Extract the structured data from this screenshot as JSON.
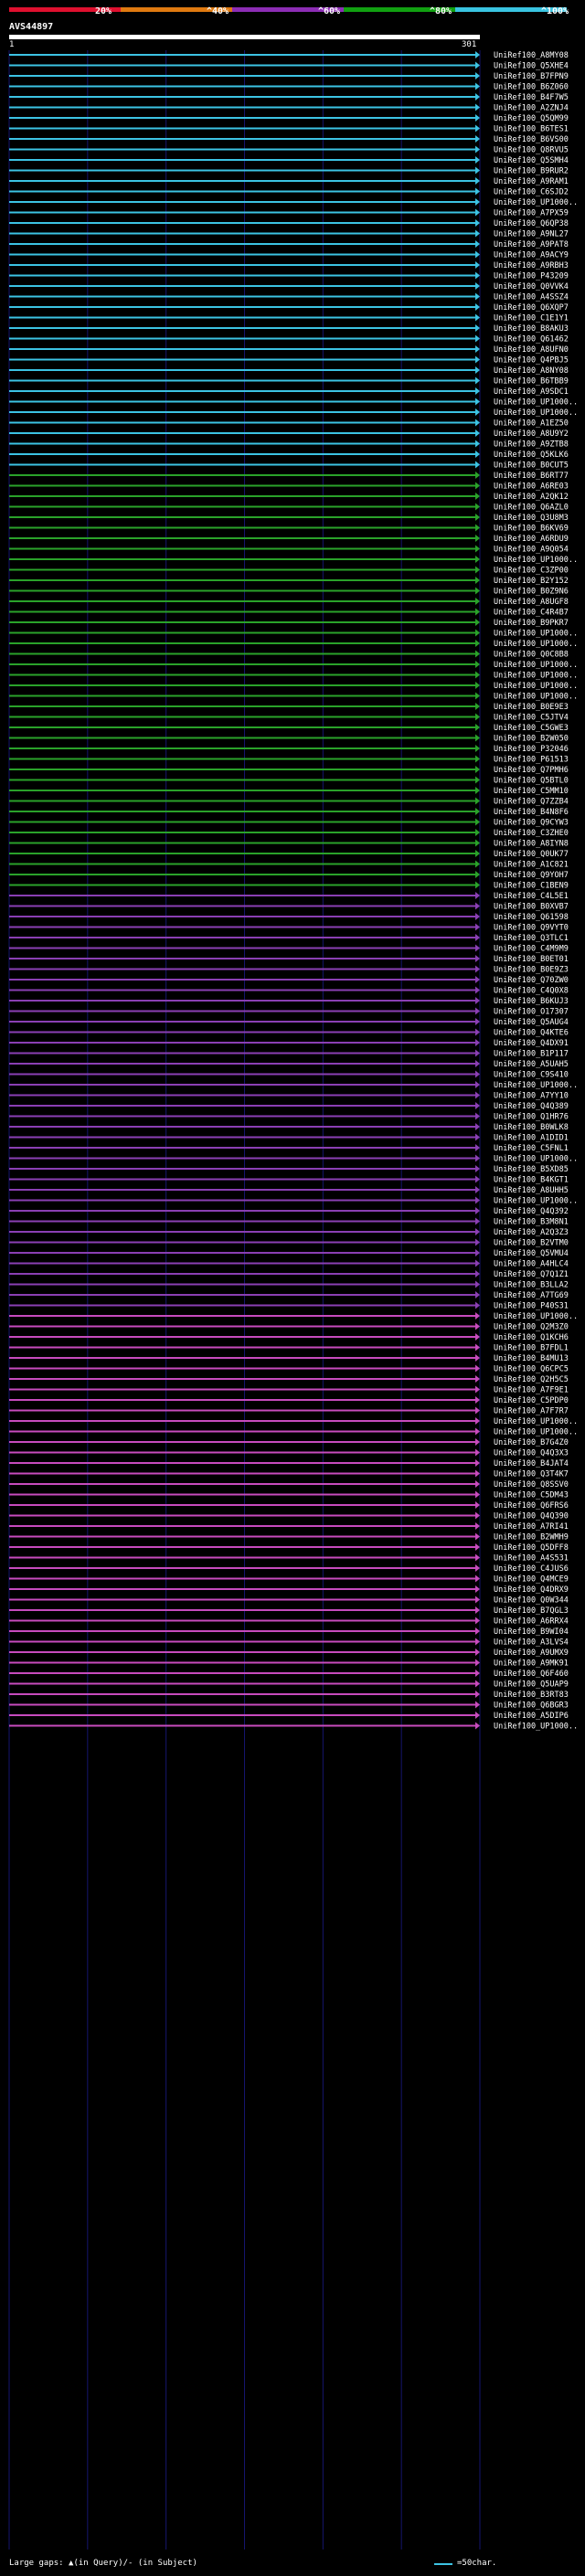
{
  "legend": {
    "labels": [
      "20%",
      "^40%",
      "^60%",
      "^80%",
      "^100%"
    ],
    "colors": [
      "#e0102f",
      "#e07a10",
      "#8d2db5",
      "#11a011",
      "#39c4e1"
    ]
  },
  "query": {
    "name": "AVS44897",
    "start": "1",
    "end": "301"
  },
  "colors": {
    "cyan": "#3cc3e3",
    "green": "#2aa22a",
    "magenta": "#c74bbd",
    "purple": "#8a3fb3",
    "grid": "#15156e",
    "query": "#ffffff"
  },
  "footer": {
    "gaps": "Large gaps: ▲(in Query)/- (in Subject)",
    "scale": "=50char."
  },
  "chart_data": {
    "type": "alignment-overview",
    "query_length": 301,
    "hits": [
      {
        "id": "UniRef100_A8MY08",
        "start": 1,
        "end": 301,
        "identity": 100
      },
      {
        "id": "UniRef100_Q5XHE4",
        "start": 1,
        "end": 301,
        "identity": 99
      },
      {
        "id": "UniRef100_B7FPN9",
        "start": 1,
        "end": 301,
        "identity": 98
      },
      {
        "id": "UniRef100_B6Z060",
        "start": 1,
        "end": 301,
        "identity": 98
      },
      {
        "id": "UniRef100_B4F7W5",
        "start": 1,
        "end": 301,
        "identity": 97
      },
      {
        "id": "UniRef100_A2ZNJ4",
        "start": 1,
        "end": 301,
        "identity": 97
      },
      {
        "id": "UniRef100_Q5QM99",
        "start": 1,
        "end": 301,
        "identity": 96
      },
      {
        "id": "UniRef100_B6TES1",
        "start": 1,
        "end": 301,
        "identity": 96
      },
      {
        "id": "UniRef100_B6VS00",
        "start": 1,
        "end": 301,
        "identity": 95
      },
      {
        "id": "UniRef100_Q8RVU5",
        "start": 1,
        "end": 301,
        "identity": 95
      },
      {
        "id": "UniRef100_Q5SMH4",
        "start": 1,
        "end": 301,
        "identity": 94
      },
      {
        "id": "UniRef100_B9RUR2",
        "start": 1,
        "end": 301,
        "identity": 94
      },
      {
        "id": "UniRef100_A9RAM1",
        "start": 1,
        "end": 301,
        "identity": 93
      },
      {
        "id": "UniRef100_C6SJD2",
        "start": 1,
        "end": 301,
        "identity": 93
      },
      {
        "id": "UniRef100_UP1000..",
        "start": 1,
        "end": 301,
        "identity": 92
      },
      {
        "id": "UniRef100_A7PX59",
        "start": 1,
        "end": 301,
        "identity": 92
      },
      {
        "id": "UniRef100_Q6QP38",
        "start": 1,
        "end": 301,
        "identity": 91
      },
      {
        "id": "UniRef100_A9NL27",
        "start": 1,
        "end": 301,
        "identity": 91
      },
      {
        "id": "UniRef100_A9PAT8",
        "start": 1,
        "end": 301,
        "identity": 90
      },
      {
        "id": "UniRef100_A9ACY9",
        "start": 1,
        "end": 301,
        "identity": 90
      },
      {
        "id": "UniRef100_A9RBH3",
        "start": 1,
        "end": 301,
        "identity": 89
      },
      {
        "id": "UniRef100_P43209",
        "start": 1,
        "end": 301,
        "identity": 89
      },
      {
        "id": "UniRef100_Q0VVK4",
        "start": 1,
        "end": 301,
        "identity": 88
      },
      {
        "id": "UniRef100_A4SSZ4",
        "start": 1,
        "end": 301,
        "identity": 88
      },
      {
        "id": "UniRef100_Q6XQP7",
        "start": 1,
        "end": 301,
        "identity": 87
      },
      {
        "id": "UniRef100_C1E1Y1",
        "start": 1,
        "end": 301,
        "identity": 87
      },
      {
        "id": "UniRef100_B8AKU3",
        "start": 1,
        "end": 301,
        "identity": 86
      },
      {
        "id": "UniRef100_Q61462",
        "start": 1,
        "end": 301,
        "identity": 86
      },
      {
        "id": "UniRef100_A8UFN0",
        "start": 1,
        "end": 301,
        "identity": 85
      },
      {
        "id": "UniRef100_Q4PBJ5",
        "start": 1,
        "end": 301,
        "identity": 85
      },
      {
        "id": "UniRef100_A8NY08",
        "start": 1,
        "end": 301,
        "identity": 84
      },
      {
        "id": "UniRef100_B6TBB9",
        "start": 1,
        "end": 301,
        "identity": 84
      },
      {
        "id": "UniRef100_A9SDC1",
        "start": 1,
        "end": 301,
        "identity": 83
      },
      {
        "id": "UniRef100_UP1000..",
        "start": 1,
        "end": 301,
        "identity": 83
      },
      {
        "id": "UniRef100_UP1000..",
        "start": 1,
        "end": 301,
        "identity": 82
      },
      {
        "id": "UniRef100_A1EZ50",
        "start": 1,
        "end": 301,
        "identity": 82
      },
      {
        "id": "UniRef100_A8U9Y2",
        "start": 1,
        "end": 301,
        "identity": 81
      },
      {
        "id": "UniRef100_A9ZTB8",
        "start": 1,
        "end": 301,
        "identity": 81
      },
      {
        "id": "UniRef100_Q5KLK6",
        "start": 1,
        "end": 301,
        "identity": 80
      },
      {
        "id": "UniRef100_B0CUT5",
        "start": 1,
        "end": 301,
        "identity": 80
      },
      {
        "id": "UniRef100_B6RT77",
        "start": 1,
        "end": 301,
        "identity": 79
      },
      {
        "id": "UniRef100_A6RE03",
        "start": 1,
        "end": 301,
        "identity": 79
      },
      {
        "id": "UniRef100_A2QK12",
        "start": 1,
        "end": 301,
        "identity": 78
      },
      {
        "id": "UniRef100_Q6AZL0",
        "start": 1,
        "end": 301,
        "identity": 78
      },
      {
        "id": "UniRef100_Q3U8M3",
        "start": 1,
        "end": 301,
        "identity": 77
      },
      {
        "id": "UniRef100_B6KV69",
        "start": 1,
        "end": 301,
        "identity": 77
      },
      {
        "id": "UniRef100_A6RDU9",
        "start": 1,
        "end": 301,
        "identity": 76
      },
      {
        "id": "UniRef100_A9Q054",
        "start": 1,
        "end": 301,
        "identity": 76
      },
      {
        "id": "UniRef100_UP1000..",
        "start": 1,
        "end": 301,
        "identity": 75
      },
      {
        "id": "UniRef100_C3ZP00",
        "start": 1,
        "end": 301,
        "identity": 75
      },
      {
        "id": "UniRef100_B2Y152",
        "start": 1,
        "end": 301,
        "identity": 74
      },
      {
        "id": "UniRef100_B0Z9N6",
        "start": 1,
        "end": 301,
        "identity": 74
      },
      {
        "id": "UniRef100_A8UGF8",
        "start": 1,
        "end": 301,
        "identity": 73
      },
      {
        "id": "UniRef100_C4R4B7",
        "start": 1,
        "end": 301,
        "identity": 73
      },
      {
        "id": "UniRef100_B9PKR7",
        "start": 1,
        "end": 301,
        "identity": 72
      },
      {
        "id": "UniRef100_UP1000..",
        "start": 1,
        "end": 301,
        "identity": 72
      },
      {
        "id": "UniRef100_UP1000..",
        "start": 1,
        "end": 301,
        "identity": 71
      },
      {
        "id": "UniRef100_Q0C8B8",
        "start": 1,
        "end": 301,
        "identity": 71
      },
      {
        "id": "UniRef100_UP1000..",
        "start": 1,
        "end": 301,
        "identity": 70
      },
      {
        "id": "UniRef100_UP1000..",
        "start": 1,
        "end": 301,
        "identity": 70
      },
      {
        "id": "UniRef100_UP1000..",
        "start": 1,
        "end": 301,
        "identity": 69
      },
      {
        "id": "UniRef100_UP1000..",
        "start": 1,
        "end": 301,
        "identity": 69
      },
      {
        "id": "UniRef100_B0E9E3",
        "start": 1,
        "end": 301,
        "identity": 68
      },
      {
        "id": "UniRef100_C5JTV4",
        "start": 1,
        "end": 301,
        "identity": 68
      },
      {
        "id": "UniRef100_C5GWE3",
        "start": 1,
        "end": 301,
        "identity": 67
      },
      {
        "id": "UniRef100_B2W050",
        "start": 1,
        "end": 301,
        "identity": 67
      },
      {
        "id": "UniRef100_P32046",
        "start": 1,
        "end": 301,
        "identity": 66
      },
      {
        "id": "UniRef100_P61513",
        "start": 1,
        "end": 301,
        "identity": 66
      },
      {
        "id": "UniRef100_Q7PMH6",
        "start": 1,
        "end": 301,
        "identity": 65
      },
      {
        "id": "UniRef100_Q5BTL0",
        "start": 1,
        "end": 301,
        "identity": 65
      },
      {
        "id": "UniRef100_C5MM10",
        "start": 1,
        "end": 301,
        "identity": 64
      },
      {
        "id": "UniRef100_Q7ZZB4",
        "start": 1,
        "end": 301,
        "identity": 64
      },
      {
        "id": "UniRef100_B4N8F6",
        "start": 1,
        "end": 301,
        "identity": 63
      },
      {
        "id": "UniRef100_Q9CYW3",
        "start": 1,
        "end": 301,
        "identity": 63
      },
      {
        "id": "UniRef100_C3ZHE0",
        "start": 1,
        "end": 301,
        "identity": 62
      },
      {
        "id": "UniRef100_A8IYN8",
        "start": 1,
        "end": 301,
        "identity": 62
      },
      {
        "id": "UniRef100_Q0UK77",
        "start": 1,
        "end": 301,
        "identity": 61
      },
      {
        "id": "UniRef100_A1C821",
        "start": 1,
        "end": 301,
        "identity": 61
      },
      {
        "id": "UniRef100_Q9YOH7",
        "start": 1,
        "end": 301,
        "identity": 60
      },
      {
        "id": "UniRef100_C1BEN9",
        "start": 1,
        "end": 301,
        "identity": 60
      },
      {
        "id": "UniRef100_C4L5E1",
        "start": 1,
        "end": 301,
        "identity": 59
      },
      {
        "id": "UniRef100_B0XVB7",
        "start": 1,
        "end": 301,
        "identity": 59
      },
      {
        "id": "UniRef100_Q61598",
        "start": 1,
        "end": 301,
        "identity": 58
      },
      {
        "id": "UniRef100_Q9VYT0",
        "start": 1,
        "end": 301,
        "identity": 58
      },
      {
        "id": "UniRef100_Q3TLC1",
        "start": 1,
        "end": 301,
        "identity": 57
      },
      {
        "id": "UniRef100_C4M9M9",
        "start": 1,
        "end": 301,
        "identity": 57
      },
      {
        "id": "UniRef100_B0ET01",
        "start": 1,
        "end": 301,
        "identity": 56
      },
      {
        "id": "UniRef100_B0E9Z3",
        "start": 1,
        "end": 301,
        "identity": 56
      },
      {
        "id": "UniRef100_Q70ZW0",
        "start": 1,
        "end": 301,
        "identity": 55
      },
      {
        "id": "UniRef100_C4Q0X8",
        "start": 1,
        "end": 301,
        "identity": 55
      },
      {
        "id": "UniRef100_B6KUJ3",
        "start": 1,
        "end": 301,
        "identity": 54
      },
      {
        "id": "UniRef100_O17307",
        "start": 1,
        "end": 301,
        "identity": 54
      },
      {
        "id": "UniRef100_Q5AUG4",
        "start": 1,
        "end": 301,
        "identity": 53
      },
      {
        "id": "UniRef100_Q4KTE6",
        "start": 1,
        "end": 301,
        "identity": 53
      },
      {
        "id": "UniRef100_Q4DX91",
        "start": 1,
        "end": 301,
        "identity": 52
      },
      {
        "id": "UniRef100_B1P117",
        "start": 1,
        "end": 301,
        "identity": 52
      },
      {
        "id": "UniRef100_A5UAH5",
        "start": 1,
        "end": 301,
        "identity": 51
      },
      {
        "id": "UniRef100_C9S410",
        "start": 1,
        "end": 301,
        "identity": 51
      },
      {
        "id": "UniRef100_UP1000..",
        "start": 1,
        "end": 301,
        "identity": 50
      },
      {
        "id": "UniRef100_A7YY10",
        "start": 1,
        "end": 301,
        "identity": 50
      },
      {
        "id": "UniRef100_Q4Q389",
        "start": 1,
        "end": 301,
        "identity": 49
      },
      {
        "id": "UniRef100_Q1HR76",
        "start": 1,
        "end": 301,
        "identity": 49
      },
      {
        "id": "UniRef100_B0WLK8",
        "start": 1,
        "end": 301,
        "identity": 48
      },
      {
        "id": "UniRef100_A1DID1",
        "start": 1,
        "end": 301,
        "identity": 48
      },
      {
        "id": "UniRef100_C5FNL1",
        "start": 1,
        "end": 301,
        "identity": 47
      },
      {
        "id": "UniRef100_UP1000..",
        "start": 1,
        "end": 301,
        "identity": 47
      },
      {
        "id": "UniRef100_B5XD85",
        "start": 1,
        "end": 301,
        "identity": 46
      },
      {
        "id": "UniRef100_B4KGT1",
        "start": 1,
        "end": 301,
        "identity": 46
      },
      {
        "id": "UniRef100_A8UHH5",
        "start": 1,
        "end": 301,
        "identity": 45
      },
      {
        "id": "UniRef100_UP1000..",
        "start": 1,
        "end": 301,
        "identity": 45
      },
      {
        "id": "UniRef100_Q4Q392",
        "start": 1,
        "end": 301,
        "identity": 44
      },
      {
        "id": "UniRef100_B3M8N1",
        "start": 1,
        "end": 301,
        "identity": 44
      },
      {
        "id": "UniRef100_A2Q3Z3",
        "start": 1,
        "end": 301,
        "identity": 43
      },
      {
        "id": "UniRef100_B2VTM0",
        "start": 1,
        "end": 301,
        "identity": 43
      },
      {
        "id": "UniRef100_Q5VMU4",
        "start": 1,
        "end": 301,
        "identity": 42
      },
      {
        "id": "UniRef100_A4HLC4",
        "start": 1,
        "end": 301,
        "identity": 42
      },
      {
        "id": "UniRef100_Q7Q1Z1",
        "start": 1,
        "end": 301,
        "identity": 41
      },
      {
        "id": "UniRef100_B3LLA2",
        "start": 1,
        "end": 301,
        "identity": 41
      },
      {
        "id": "UniRef100_A7TG69",
        "start": 1,
        "end": 301,
        "identity": 40
      },
      {
        "id": "UniRef100_P40S31",
        "start": 1,
        "end": 301,
        "identity": 40
      },
      {
        "id": "UniRef100_UP1000..",
        "start": 1,
        "end": 301,
        "identity": 39
      },
      {
        "id": "UniRef100_Q2M3Z0",
        "start": 1,
        "end": 301,
        "identity": 39
      },
      {
        "id": "UniRef100_Q1KCH6",
        "start": 1,
        "end": 301,
        "identity": 38
      },
      {
        "id": "UniRef100_B7FDL1",
        "start": 1,
        "end": 301,
        "identity": 38
      },
      {
        "id": "UniRef100_B4MU13",
        "start": 1,
        "end": 301,
        "identity": 37
      },
      {
        "id": "UniRef100_Q6CPC5",
        "start": 1,
        "end": 301,
        "identity": 37
      },
      {
        "id": "UniRef100_Q2H5C5",
        "start": 1,
        "end": 301,
        "identity": 36
      },
      {
        "id": "UniRef100_A7F9E1",
        "start": 1,
        "end": 301,
        "identity": 36
      },
      {
        "id": "UniRef100_C5PDP0",
        "start": 1,
        "end": 301,
        "identity": 35
      },
      {
        "id": "UniRef100_A7F7R7",
        "start": 1,
        "end": 301,
        "identity": 35
      },
      {
        "id": "UniRef100_UP1000..",
        "start": 1,
        "end": 301,
        "identity": 34
      },
      {
        "id": "UniRef100_UP1000..",
        "start": 1,
        "end": 301,
        "identity": 34
      },
      {
        "id": "UniRef100_B7G4Z0",
        "start": 1,
        "end": 301,
        "identity": 33
      },
      {
        "id": "UniRef100_Q4Q3X3",
        "start": 1,
        "end": 301,
        "identity": 33
      },
      {
        "id": "UniRef100_B4JAT4",
        "start": 1,
        "end": 301,
        "identity": 32
      },
      {
        "id": "UniRef100_Q3T4K7",
        "start": 1,
        "end": 301,
        "identity": 32
      },
      {
        "id": "UniRef100_Q8SSV0",
        "start": 1,
        "end": 301,
        "identity": 31
      },
      {
        "id": "UniRef100_C5DM43",
        "start": 1,
        "end": 301,
        "identity": 31
      },
      {
        "id": "UniRef100_Q6FRS6",
        "start": 1,
        "end": 301,
        "identity": 30
      },
      {
        "id": "UniRef100_Q4Q390",
        "start": 1,
        "end": 301,
        "identity": 30
      },
      {
        "id": "UniRef100_A7RI41",
        "start": 1,
        "end": 301,
        "identity": 29
      },
      {
        "id": "UniRef100_B2WMH9",
        "start": 1,
        "end": 301,
        "identity": 29
      },
      {
        "id": "UniRef100_Q5DFF8",
        "start": 1,
        "end": 301,
        "identity": 28
      },
      {
        "id": "UniRef100_A4S531",
        "start": 1,
        "end": 301,
        "identity": 28
      },
      {
        "id": "UniRef100_C4JUS6",
        "start": 1,
        "end": 301,
        "identity": 27
      },
      {
        "id": "UniRef100_Q4MCE9",
        "start": 1,
        "end": 301,
        "identity": 27
      },
      {
        "id": "UniRef100_Q4DRX9",
        "start": 1,
        "end": 301,
        "identity": 26
      },
      {
        "id": "UniRef100_Q0W344",
        "start": 1,
        "end": 301,
        "identity": 26
      },
      {
        "id": "UniRef100_B7QGL3",
        "start": 1,
        "end": 301,
        "identity": 25
      },
      {
        "id": "UniRef100_A6RRX4",
        "start": 1,
        "end": 301,
        "identity": 25
      },
      {
        "id": "UniRef100_B9WI04",
        "start": 1,
        "end": 301,
        "identity": 24
      },
      {
        "id": "UniRef100_A3LVS4",
        "start": 1,
        "end": 301,
        "identity": 24
      },
      {
        "id": "UniRef100_A9UMX9",
        "start": 1,
        "end": 301,
        "identity": 23
      },
      {
        "id": "UniRef100_A9MK91",
        "start": 1,
        "end": 301,
        "identity": 23
      },
      {
        "id": "UniRef100_Q6F460",
        "start": 1,
        "end": 301,
        "identity": 22
      },
      {
        "id": "UniRef100_Q5UAP9",
        "start": 1,
        "end": 301,
        "identity": 22
      },
      {
        "id": "UniRef100_B3RT83",
        "start": 1,
        "end": 301,
        "identity": 21
      },
      {
        "id": "UniRef100_Q6BGR3",
        "start": 1,
        "end": 301,
        "identity": 21
      },
      {
        "id": "UniRef100_A5DIP6",
        "start": 1,
        "end": 301,
        "identity": 20
      },
      {
        "id": "UniRef100_UP1000..",
        "start": 1,
        "end": 301,
        "identity": 20
      }
    ]
  }
}
